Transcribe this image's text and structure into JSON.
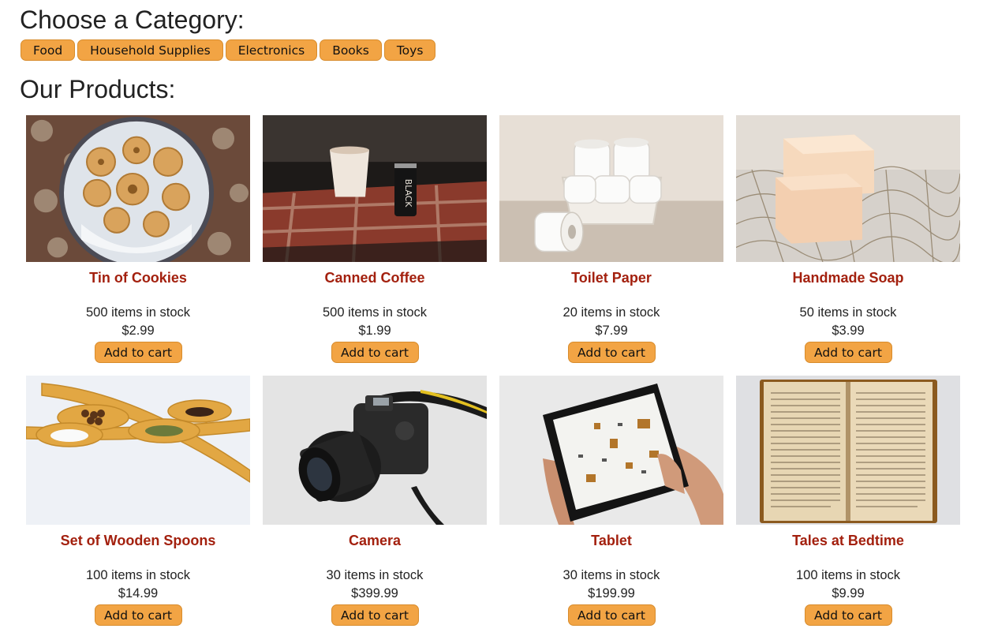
{
  "category_heading": "Choose a Category:",
  "categories": [
    "Food",
    "Household Supplies",
    "Electronics",
    "Books",
    "Toys"
  ],
  "products_heading": "Our Products:",
  "colors": {
    "accent": "#f2a444",
    "product_name": "#a3200e"
  },
  "add_label": "Add to cart",
  "products": [
    {
      "name": "Tin of Cookies",
      "stock": "500 items in stock",
      "price": "$2.99",
      "image": "cookies-photo"
    },
    {
      "name": "Canned Coffee",
      "stock": "500 items in stock",
      "price": "$1.99",
      "image": "coffee-photo"
    },
    {
      "name": "Toilet Paper",
      "stock": "20 items in stock",
      "price": "$7.99",
      "image": "toilet-paper-photo"
    },
    {
      "name": "Handmade Soap",
      "stock": "50 items in stock",
      "price": "$3.99",
      "image": "soap-photo"
    },
    {
      "name": "Set of Wooden Spoons",
      "stock": "100 items in stock",
      "price": "$14.99",
      "image": "spoons-photo"
    },
    {
      "name": "Camera",
      "stock": "30 items in stock",
      "price": "$399.99",
      "image": "camera-photo"
    },
    {
      "name": "Tablet",
      "stock": "30 items in stock",
      "price": "$199.99",
      "image": "tablet-photo"
    },
    {
      "name": "Tales at Bedtime",
      "stock": "100 items in stock",
      "price": "$9.99",
      "image": "book-photo"
    }
  ]
}
